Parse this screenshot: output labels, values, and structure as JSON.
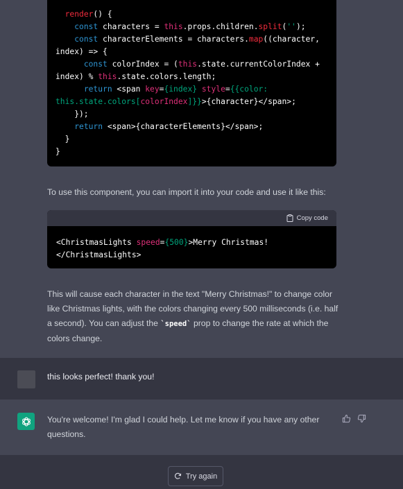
{
  "code_block_1": {
    "lines": [
      [
        [
          "  ",
          "pl"
        ],
        [
          "render",
          "fn"
        ],
        [
          "() {",
          "pl"
        ]
      ],
      [
        [
          "    ",
          "pl"
        ],
        [
          "const",
          "kw"
        ],
        [
          " characters = ",
          "pl"
        ],
        [
          "this",
          "th"
        ],
        [
          ".props.children.",
          "pl"
        ],
        [
          "split",
          "fn"
        ],
        [
          "(",
          "pl"
        ],
        [
          "''",
          "str"
        ],
        [
          ");",
          "pl"
        ]
      ],
      [
        [
          "    ",
          "pl"
        ],
        [
          "const",
          "kw"
        ],
        [
          " characterElements = characters.",
          "pl"
        ],
        [
          "map",
          "fn"
        ],
        [
          "((character,",
          "pl"
        ]
      ],
      [
        [
          "index) => {",
          "pl"
        ]
      ],
      [
        [
          "      ",
          "pl"
        ],
        [
          "const",
          "kw"
        ],
        [
          " colorIndex = (",
          "pl"
        ],
        [
          "this",
          "th"
        ],
        [
          ".state.currentColorIndex +",
          "pl"
        ]
      ],
      [
        [
          "index) % ",
          "pl"
        ],
        [
          "this",
          "th"
        ],
        [
          ".state.colors.length;",
          "pl"
        ]
      ],
      [
        [
          "      ",
          "pl"
        ],
        [
          "return",
          "kw"
        ],
        [
          " <span ",
          "pl"
        ],
        [
          "key",
          "at"
        ],
        [
          "=",
          "pl"
        ],
        [
          "{index}",
          "val"
        ],
        [
          " ",
          "pl"
        ],
        [
          "style",
          "at"
        ],
        [
          "=",
          "pl"
        ],
        [
          "{{color:",
          "val"
        ]
      ],
      [
        [
          "this",
          "val"
        ],
        [
          ".state.colors[",
          "val"
        ],
        [
          "colorIndex",
          "at"
        ],
        [
          "]}}",
          "val"
        ],
        [
          ">{character}</span>;",
          "pl"
        ]
      ],
      [
        [
          "    });",
          "pl"
        ]
      ],
      [
        [
          "    ",
          "pl"
        ],
        [
          "return",
          "kw"
        ],
        [
          " <span>{characterElements}</span>;",
          "pl"
        ]
      ],
      [
        [
          "  }",
          "pl"
        ]
      ],
      [
        [
          "}",
          "pl"
        ]
      ]
    ]
  },
  "para_1": "To use this component, you can import it into your code and use it like this:",
  "code_block_2": {
    "copy_label": "Copy code",
    "lines": [
      [
        [
          "<ChristmasLights ",
          "pl"
        ],
        [
          "speed",
          "at"
        ],
        [
          "=",
          "pl"
        ],
        [
          "{500}",
          "val"
        ],
        [
          ">Merry Christmas!",
          "pl"
        ]
      ],
      [
        [
          "</ChristmasLights>",
          "pl"
        ]
      ]
    ]
  },
  "para_2": {
    "before": "This will cause each character in the text \"Merry Christmas!\" to change color like Christmas lights, with the colors changing every 500 milliseconds (i.e. half a second). You can adjust the ",
    "code": "`speed`",
    "after": " prop to change the rate at which the colors change."
  },
  "user_message": "this looks perfect! thank you!",
  "assistant_message": "You're welcome! I'm glad I could help. Let me know if you have any other questions.",
  "try_again_label": "Try again",
  "colors": {
    "background": "#444654",
    "user_row": "#343541",
    "code_bg": "#000000",
    "assistant_avatar": "#10a37f"
  }
}
